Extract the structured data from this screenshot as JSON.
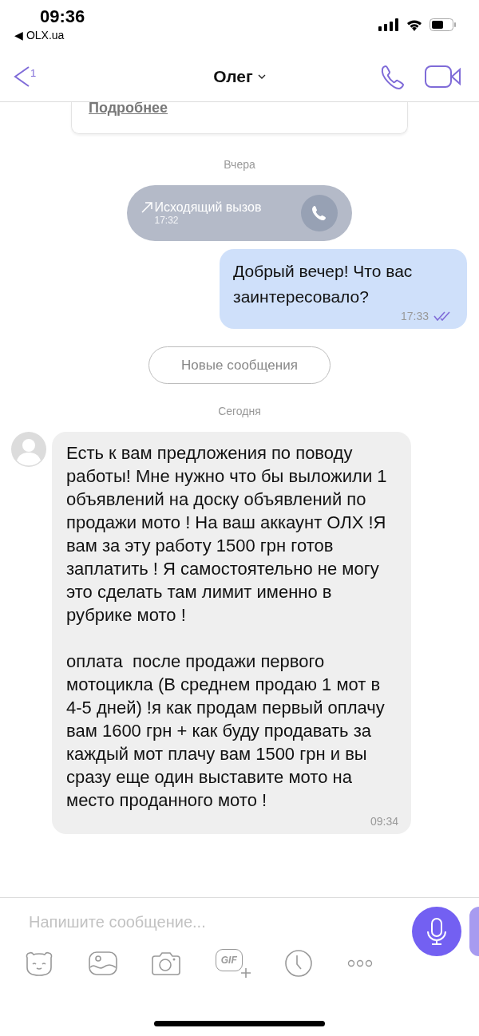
{
  "status_bar": {
    "time": "09:36",
    "back_app": "◀ OLX.ua"
  },
  "header": {
    "back_count": "1",
    "contact": "Олег"
  },
  "chat": {
    "card_link": "Подробнее",
    "day_1": "Вчера",
    "call": {
      "label": "Исходящий вызов",
      "time": "17:32"
    },
    "outgoing": {
      "text": "Добрый вечер! Что вас заинтересовало?",
      "time": "17:33",
      "read": true
    },
    "new_messages": "Новые сообщения",
    "day_2": "Сегодня",
    "incoming": {
      "paragraphs": [
        "Есть к вам предложения по поводу работы! Мне нужно что бы выложили 1 объявлений на доску объявлений по продажи мото ! На ваш аккаунт ОЛХ !Я вам за эту работу 1500 грн готов заплатить ! Я самостоятельно не могу это сделать там лимит именно в рубрике мото !",
        "оплата  после продажи первого мотоцикла (В среднем продаю 1 мот в 4-5 дней) !я как продам первый оплачу вам 1600 грн + как буду продавать за каждый мот плачу вам 1500 грн и вы сразу еще один выставите мото на место проданного мото !"
      ],
      "time": "09:34"
    }
  },
  "composer": {
    "placeholder": "Напишите сообщение...",
    "gif_label": "GIF"
  }
}
